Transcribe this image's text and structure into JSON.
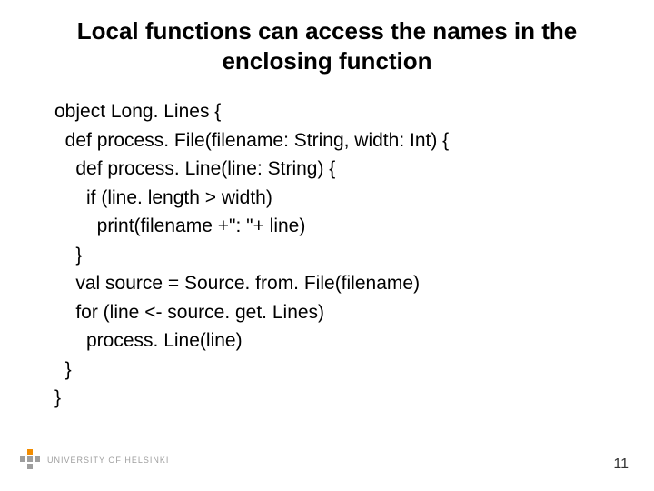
{
  "title": "Local functions can access the names in the enclosing function",
  "code": {
    "l1": "object Long. Lines {",
    "l2": "  def process. File(filename: String, width: Int) {",
    "l3": "    def process. Line(line: String) {",
    "l4": "      if (line. length > width)",
    "l5": "        print(filename +\": \"+ line)",
    "l6": "    }",
    "l7": "",
    "l8": "    val source = Source. from. File(filename)",
    "l9": "    for (line <- source. get. Lines)",
    "l10": "      process. Line(line)",
    "l11": "  }",
    "l12": "}"
  },
  "footer": {
    "pagenum": "11",
    "university": "UNIVERSITY OF HELSINKI"
  }
}
